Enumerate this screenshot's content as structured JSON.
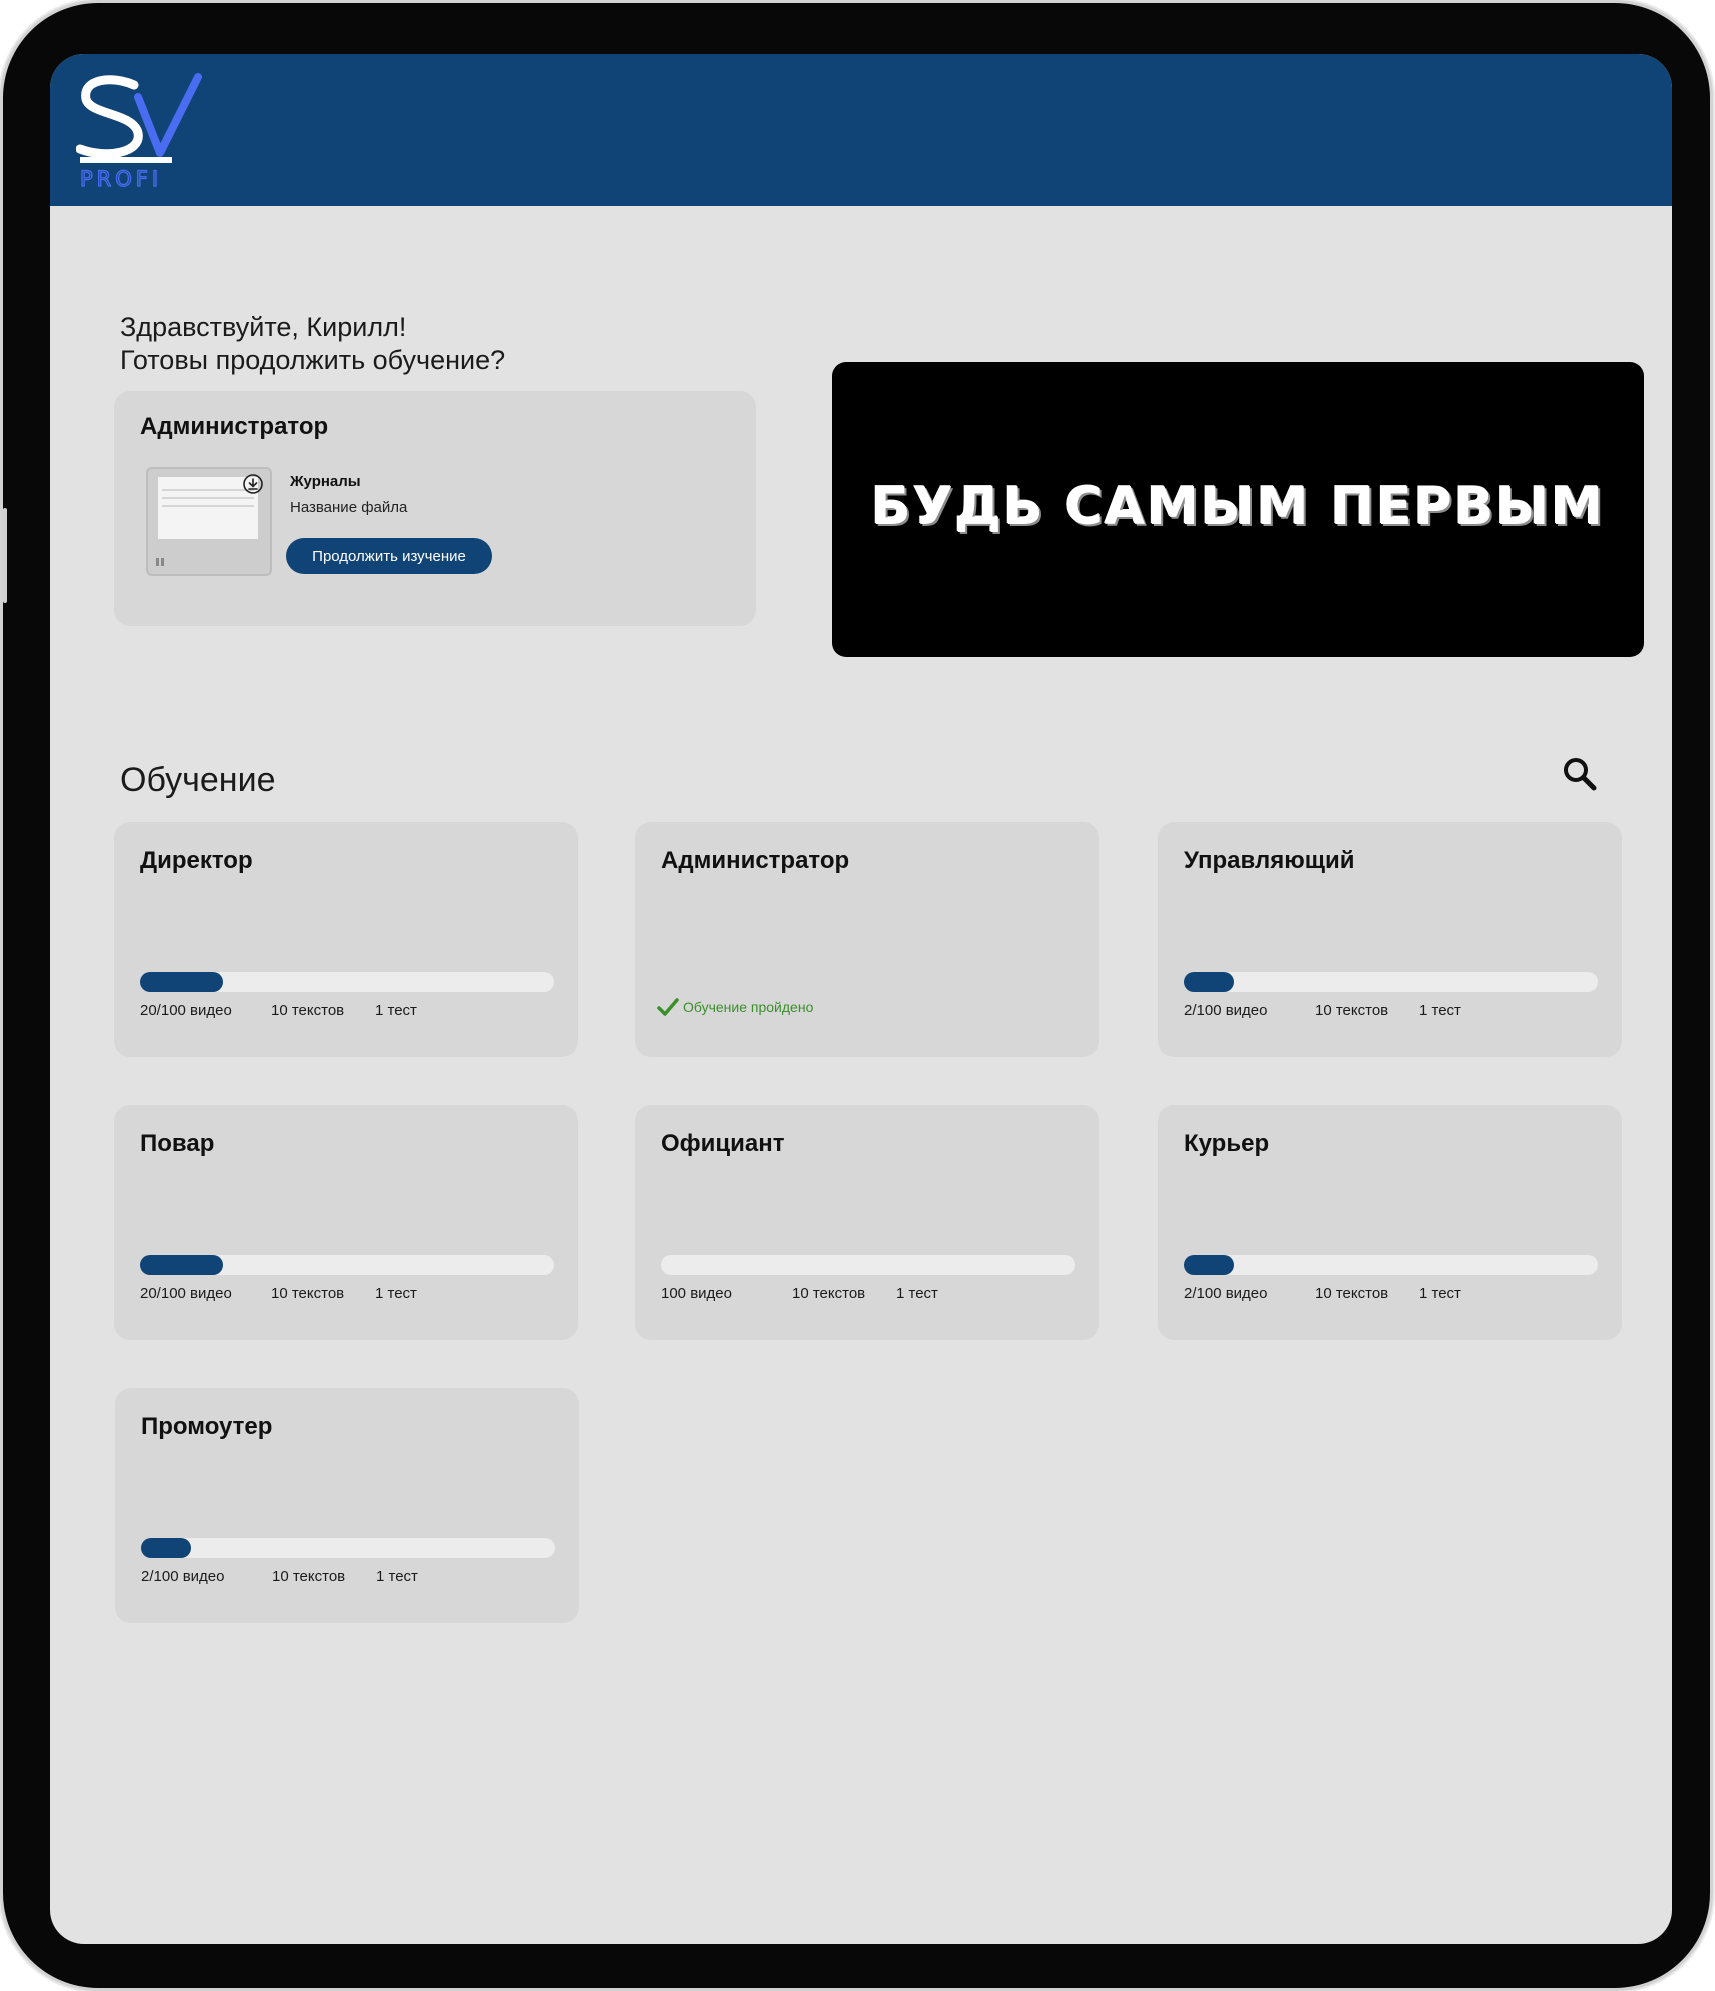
{
  "brand": {
    "logo_text": "PROFI",
    "logo_letters": "SV",
    "color": "#114476",
    "accent": "#4a6cf0"
  },
  "greeting": {
    "line1": "Здравствуйте, Кирилл!",
    "line2": "Готовы продолжить обучение?"
  },
  "continue_card": {
    "title": "Администратор",
    "file_title": "Журналы",
    "file_name": "Название файла",
    "button_label": "Продолжить изучение"
  },
  "banner": {
    "text": "БУДЬ САМЫМ ПЕРВЫМ"
  },
  "learning": {
    "title": "Обучение",
    "search_icon": "search-icon",
    "courses": [
      {
        "title": "Директор",
        "progress": 0.2,
        "videos": "20/100 видео",
        "texts": "10 текстов",
        "tests": "1 тест"
      },
      {
        "title": "Администратор",
        "completed": true,
        "completed_label": "Обучение пройдено"
      },
      {
        "title": "Управляющий",
        "progress": 0.12,
        "videos": "2/100 видео",
        "texts": "10 текстов",
        "tests": "1 тест"
      },
      {
        "title": "Повар",
        "progress": 0.2,
        "videos": "20/100 видео",
        "texts": "10 текстов",
        "tests": "1 тест"
      },
      {
        "title": "Официант",
        "progress": 0,
        "videos": "100 видео",
        "texts": "10 текстов",
        "tests": "1 тест"
      },
      {
        "title": "Курьер",
        "progress": 0.12,
        "videos": "2/100 видео",
        "texts": "10 текстов",
        "tests": "1 тест"
      },
      {
        "title": "Промоутер",
        "progress": 0.12,
        "videos": "2/100 видео",
        "texts": "10 текстов",
        "tests": "1 тест"
      }
    ]
  }
}
